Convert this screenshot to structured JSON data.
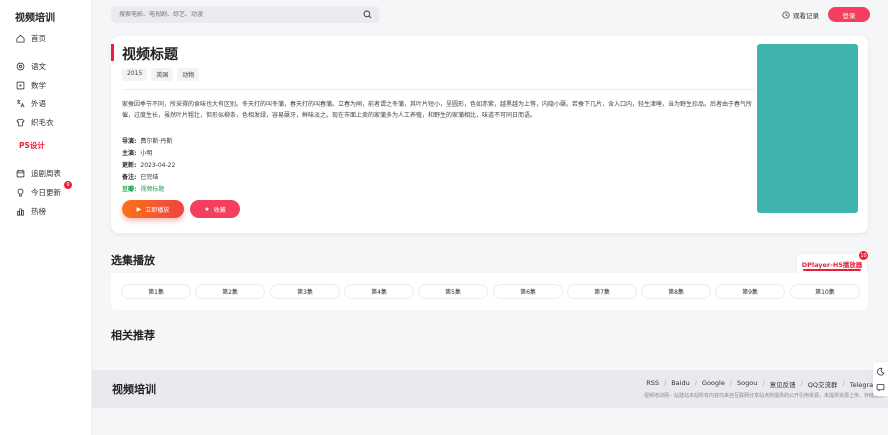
{
  "sidebar": {
    "logo": "视频培训",
    "items": [
      {
        "label": "首页",
        "icon": "home-icon"
      },
      {
        "label": "语文",
        "icon": "book-icon"
      },
      {
        "label": "数学",
        "icon": "calculator-icon"
      },
      {
        "label": "外语",
        "icon": "translate-icon"
      },
      {
        "label": "织毛衣",
        "icon": "shirt-icon"
      },
      {
        "label": "PS设计",
        "icon": ""
      },
      {
        "label": "追剧周表",
        "icon": "calendar-icon"
      },
      {
        "label": "今日更新",
        "icon": "bulb-icon"
      },
      {
        "label": "热榜",
        "icon": "chart-icon"
      }
    ],
    "update_badge": "9"
  },
  "header": {
    "search_placeholder": "搜索电影、电视剧、综艺、动漫",
    "history_label": "观看记录",
    "login_label": "登录"
  },
  "detail": {
    "title": "视频标题",
    "tags": [
      "2015",
      "英国",
      "动物"
    ],
    "description": "家蚕因季节不同，所采得的食味也大有区别。冬天打的叫冬蒲，春天打的叫春蒲。立春为闸，前者谓之冬蒲，其叶片短小，呈圆形，色如赤紫，越黑越为上等，内隐小蘖。若蚕下几片，含入口内，轻生津唾，当为野生珍品。后者由于春气所催，过度生长，虽然叶片粗壮，但形似柳条，色相发绿，容易蘖牙，鲜味淡之。现在市面上卖的家蒲多为人工养殖，和野生的家蒲相比，味道不可同日而语。",
    "meta": [
      {
        "key": "导演:",
        "value": "费尔斯·丹斯"
      },
      {
        "key": "主演:",
        "value": "小明"
      },
      {
        "key": "更新:",
        "value": "2023-04-22"
      },
      {
        "key": "备注:",
        "value": "已完结"
      },
      {
        "key": "豆瓣:",
        "value": "视频标题"
      }
    ],
    "play_label": "立即播放",
    "fav_label": "收藏",
    "poster_color": "#40b3ae"
  },
  "episodes": {
    "section_title": "选集播放",
    "player_tab": "DPlayer-H5播放器",
    "player_badge": "10",
    "items": [
      "第1集",
      "第2集",
      "第3集",
      "第4集",
      "第5集",
      "第6集",
      "第7集",
      "第8集",
      "第9集",
      "第10集"
    ]
  },
  "related": {
    "section_title": "相关推荐"
  },
  "footer": {
    "title": "视频培训",
    "links": [
      "RSS",
      "Baidu",
      "Google",
      "Sogou",
      "意见反馈",
      "QQ交流群",
      "Telegram群"
    ],
    "note": "视频培训网 - 站建站本站所有内容均来自互联网分享站点所提供的公开引用资源，未提供资源上传、存储服务"
  },
  "colors": {
    "accent": "#e8203a",
    "button": "#f43f5e",
    "green": "#16a34a"
  }
}
